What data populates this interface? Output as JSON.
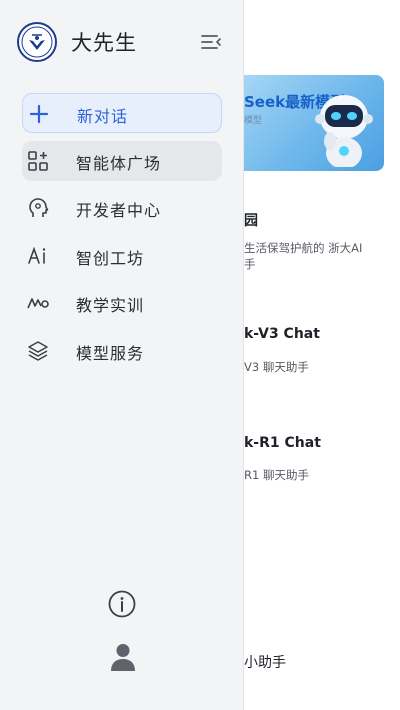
{
  "background": {
    "banner": {
      "title": "Seek最新模型",
      "subtitle": "模型"
    },
    "items": [
      {
        "title": "园",
        "desc": "生活保驾护航的 浙大AI"
      },
      {
        "title": "k-V3 Chat",
        "desc": "V3 聊天助手"
      },
      {
        "title": "k-R1 Chat",
        "desc": "R1 聊天助手"
      },
      {
        "title": "小助手",
        "desc": ""
      }
    ],
    "desc_extra": "手"
  },
  "drawer": {
    "app_name": "大先生",
    "menu": [
      {
        "label": "新对话",
        "icon": "plus-icon",
        "state": "active"
      },
      {
        "label": "智能体广场",
        "icon": "grid-shapes-icon",
        "state": "hover"
      },
      {
        "label": "开发者中心",
        "icon": "head-gear-icon",
        "state": "normal"
      },
      {
        "label": "智创工坊",
        "icon": "ai-text-icon",
        "state": "normal"
      },
      {
        "label": "教学实训",
        "icon": "wave-teaching-icon",
        "state": "normal"
      },
      {
        "label": "模型服务",
        "icon": "layers-icon",
        "state": "normal"
      }
    ]
  },
  "colors": {
    "accent": "#2b63d9",
    "drawer_bg": "#f3f4f6",
    "active_bg": "#e7effd"
  }
}
